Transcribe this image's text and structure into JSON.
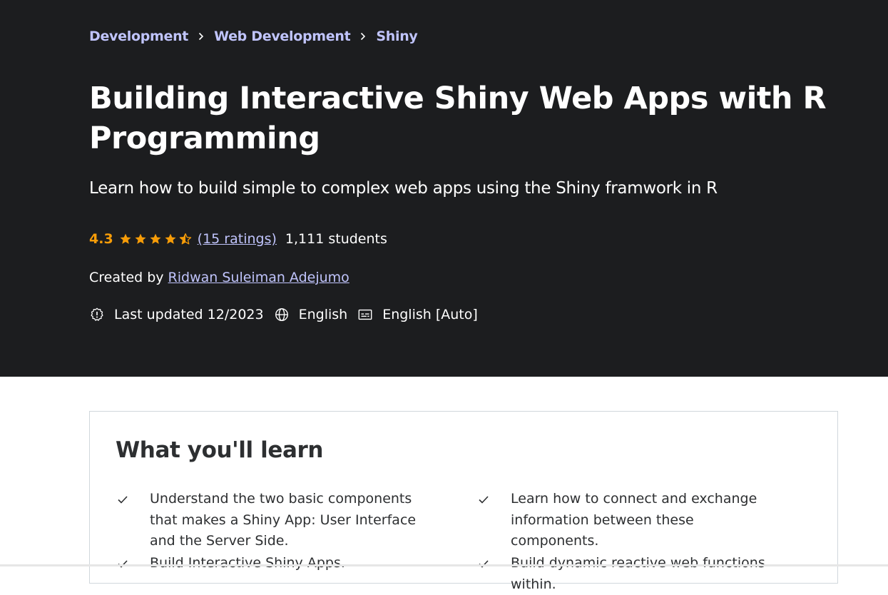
{
  "breadcrumb": [
    {
      "label": "Development"
    },
    {
      "label": "Web Development"
    },
    {
      "label": "Shiny"
    }
  ],
  "course": {
    "title": "Building Interactive Shiny Web Apps with R Programming",
    "subtitle": "Learn how to build simple to complex web apps using the Shiny framwork in R",
    "rating_value": "4.3",
    "rating_stars": 4.3,
    "ratings_link": "(15 ratings)",
    "students": "1,111 students",
    "created_prefix": "Created by",
    "instructor": "Ridwan Suleiman Adejumo",
    "last_updated": "Last updated 12/2023",
    "language": "English",
    "captions": "English [Auto]"
  },
  "learn": {
    "title": "What you'll learn",
    "items": [
      "Understand the two basic components that makes a Shiny App: User Interface and the Server Side.",
      "Learn how to connect and exchange information between these components.",
      "Build Interactive Shiny Apps.",
      "Build dynamic reactive web functions within."
    ]
  },
  "colors": {
    "hero_bg": "#1c1d1f",
    "accent_link": "#c0c4fc",
    "star": "#f69c08",
    "text_dark": "#2d2f31"
  },
  "icons": {
    "breadcrumb_separator": "chevron-right-icon",
    "star": "star-icon",
    "updated": "alert-badge-icon",
    "language": "globe-icon",
    "captions": "closed-captions-icon",
    "learn_bullet": "check-icon"
  }
}
